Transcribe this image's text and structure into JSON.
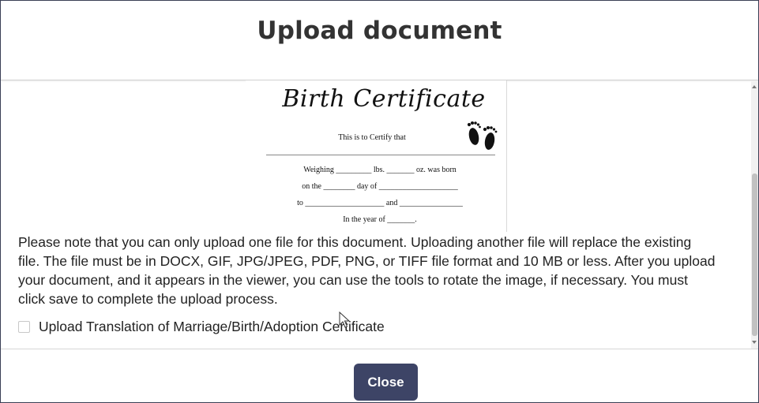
{
  "modal": {
    "title": "Upload document",
    "close_label": "Close"
  },
  "preview": {
    "certificate_title": "Birth Certificate",
    "subtitle": "This is to Certify that",
    "lines": [
      "Weighing _________ lbs. _______ oz. was born",
      "on the ________ day of ____________________",
      "to ____________________ and ________________",
      "In the year of _______."
    ],
    "icon": "baby-feet-icon"
  },
  "note": {
    "lines": [
      "Please note that you can only upload one file for this document. Uploading another file will replace the existing",
      "file. The file must be in DOCX, GIF, JPG/JPEG, PDF, PNG, or TIFF file format and 10 MB or less. After you upload",
      "your document, and it appears in the viewer, you can use the tools to rotate the image, if necessary. You must",
      "click save to complete the upload process."
    ]
  },
  "translation_checkbox": {
    "label": "Upload Translation of Marriage/Birth/Adoption Certificate",
    "checked": false
  },
  "colors": {
    "button_bg": "#3d4466",
    "title_text": "#333333",
    "border": "#3a3f55"
  }
}
